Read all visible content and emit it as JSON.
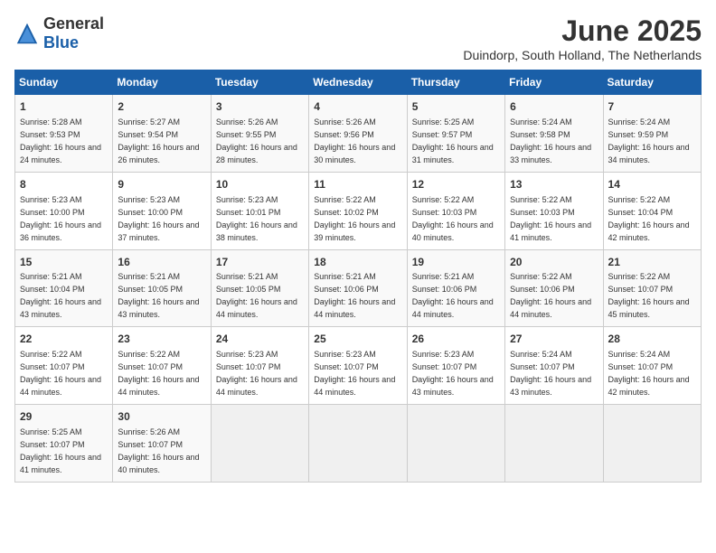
{
  "header": {
    "logo_general": "General",
    "logo_blue": "Blue",
    "month_title": "June 2025",
    "location": "Duindorp, South Holland, The Netherlands"
  },
  "calendar": {
    "days_of_week": [
      "Sunday",
      "Monday",
      "Tuesday",
      "Wednesday",
      "Thursday",
      "Friday",
      "Saturday"
    ],
    "weeks": [
      [
        {
          "day": "1",
          "sunrise": "Sunrise: 5:28 AM",
          "sunset": "Sunset: 9:53 PM",
          "daylight": "Daylight: 16 hours and 24 minutes."
        },
        {
          "day": "2",
          "sunrise": "Sunrise: 5:27 AM",
          "sunset": "Sunset: 9:54 PM",
          "daylight": "Daylight: 16 hours and 26 minutes."
        },
        {
          "day": "3",
          "sunrise": "Sunrise: 5:26 AM",
          "sunset": "Sunset: 9:55 PM",
          "daylight": "Daylight: 16 hours and 28 minutes."
        },
        {
          "day": "4",
          "sunrise": "Sunrise: 5:26 AM",
          "sunset": "Sunset: 9:56 PM",
          "daylight": "Daylight: 16 hours and 30 minutes."
        },
        {
          "day": "5",
          "sunrise": "Sunrise: 5:25 AM",
          "sunset": "Sunset: 9:57 PM",
          "daylight": "Daylight: 16 hours and 31 minutes."
        },
        {
          "day": "6",
          "sunrise": "Sunrise: 5:24 AM",
          "sunset": "Sunset: 9:58 PM",
          "daylight": "Daylight: 16 hours and 33 minutes."
        },
        {
          "day": "7",
          "sunrise": "Sunrise: 5:24 AM",
          "sunset": "Sunset: 9:59 PM",
          "daylight": "Daylight: 16 hours and 34 minutes."
        }
      ],
      [
        {
          "day": "8",
          "sunrise": "Sunrise: 5:23 AM",
          "sunset": "Sunset: 10:00 PM",
          "daylight": "Daylight: 16 hours and 36 minutes."
        },
        {
          "day": "9",
          "sunrise": "Sunrise: 5:23 AM",
          "sunset": "Sunset: 10:00 PM",
          "daylight": "Daylight: 16 hours and 37 minutes."
        },
        {
          "day": "10",
          "sunrise": "Sunrise: 5:23 AM",
          "sunset": "Sunset: 10:01 PM",
          "daylight": "Daylight: 16 hours and 38 minutes."
        },
        {
          "day": "11",
          "sunrise": "Sunrise: 5:22 AM",
          "sunset": "Sunset: 10:02 PM",
          "daylight": "Daylight: 16 hours and 39 minutes."
        },
        {
          "day": "12",
          "sunrise": "Sunrise: 5:22 AM",
          "sunset": "Sunset: 10:03 PM",
          "daylight": "Daylight: 16 hours and 40 minutes."
        },
        {
          "day": "13",
          "sunrise": "Sunrise: 5:22 AM",
          "sunset": "Sunset: 10:03 PM",
          "daylight": "Daylight: 16 hours and 41 minutes."
        },
        {
          "day": "14",
          "sunrise": "Sunrise: 5:22 AM",
          "sunset": "Sunset: 10:04 PM",
          "daylight": "Daylight: 16 hours and 42 minutes."
        }
      ],
      [
        {
          "day": "15",
          "sunrise": "Sunrise: 5:21 AM",
          "sunset": "Sunset: 10:04 PM",
          "daylight": "Daylight: 16 hours and 43 minutes."
        },
        {
          "day": "16",
          "sunrise": "Sunrise: 5:21 AM",
          "sunset": "Sunset: 10:05 PM",
          "daylight": "Daylight: 16 hours and 43 minutes."
        },
        {
          "day": "17",
          "sunrise": "Sunrise: 5:21 AM",
          "sunset": "Sunset: 10:05 PM",
          "daylight": "Daylight: 16 hours and 44 minutes."
        },
        {
          "day": "18",
          "sunrise": "Sunrise: 5:21 AM",
          "sunset": "Sunset: 10:06 PM",
          "daylight": "Daylight: 16 hours and 44 minutes."
        },
        {
          "day": "19",
          "sunrise": "Sunrise: 5:21 AM",
          "sunset": "Sunset: 10:06 PM",
          "daylight": "Daylight: 16 hours and 44 minutes."
        },
        {
          "day": "20",
          "sunrise": "Sunrise: 5:22 AM",
          "sunset": "Sunset: 10:06 PM",
          "daylight": "Daylight: 16 hours and 44 minutes."
        },
        {
          "day": "21",
          "sunrise": "Sunrise: 5:22 AM",
          "sunset": "Sunset: 10:07 PM",
          "daylight": "Daylight: 16 hours and 45 minutes."
        }
      ],
      [
        {
          "day": "22",
          "sunrise": "Sunrise: 5:22 AM",
          "sunset": "Sunset: 10:07 PM",
          "daylight": "Daylight: 16 hours and 44 minutes."
        },
        {
          "day": "23",
          "sunrise": "Sunrise: 5:22 AM",
          "sunset": "Sunset: 10:07 PM",
          "daylight": "Daylight: 16 hours and 44 minutes."
        },
        {
          "day": "24",
          "sunrise": "Sunrise: 5:23 AM",
          "sunset": "Sunset: 10:07 PM",
          "daylight": "Daylight: 16 hours and 44 minutes."
        },
        {
          "day": "25",
          "sunrise": "Sunrise: 5:23 AM",
          "sunset": "Sunset: 10:07 PM",
          "daylight": "Daylight: 16 hours and 44 minutes."
        },
        {
          "day": "26",
          "sunrise": "Sunrise: 5:23 AM",
          "sunset": "Sunset: 10:07 PM",
          "daylight": "Daylight: 16 hours and 43 minutes."
        },
        {
          "day": "27",
          "sunrise": "Sunrise: 5:24 AM",
          "sunset": "Sunset: 10:07 PM",
          "daylight": "Daylight: 16 hours and 43 minutes."
        },
        {
          "day": "28",
          "sunrise": "Sunrise: 5:24 AM",
          "sunset": "Sunset: 10:07 PM",
          "daylight": "Daylight: 16 hours and 42 minutes."
        }
      ],
      [
        {
          "day": "29",
          "sunrise": "Sunrise: 5:25 AM",
          "sunset": "Sunset: 10:07 PM",
          "daylight": "Daylight: 16 hours and 41 minutes."
        },
        {
          "day": "30",
          "sunrise": "Sunrise: 5:26 AM",
          "sunset": "Sunset: 10:07 PM",
          "daylight": "Daylight: 16 hours and 40 minutes."
        },
        {
          "day": "",
          "sunrise": "",
          "sunset": "",
          "daylight": ""
        },
        {
          "day": "",
          "sunrise": "",
          "sunset": "",
          "daylight": ""
        },
        {
          "day": "",
          "sunrise": "",
          "sunset": "",
          "daylight": ""
        },
        {
          "day": "",
          "sunrise": "",
          "sunset": "",
          "daylight": ""
        },
        {
          "day": "",
          "sunrise": "",
          "sunset": "",
          "daylight": ""
        }
      ]
    ]
  }
}
